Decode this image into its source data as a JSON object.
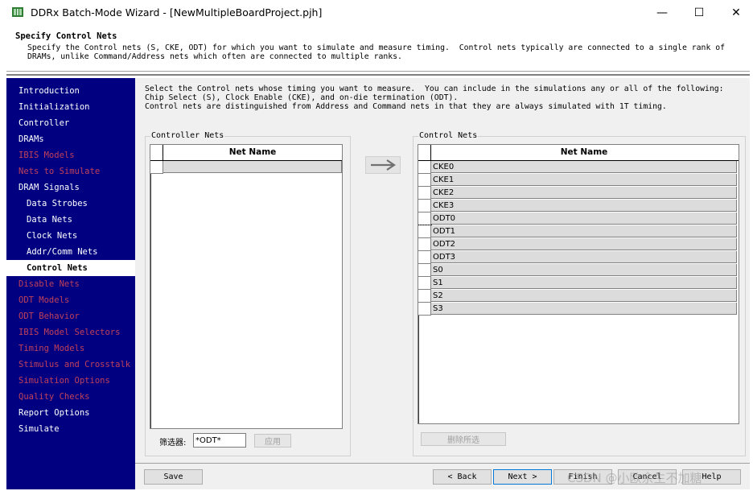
{
  "window": {
    "title": "DDRx Batch-Mode Wizard - [NewMultipleBoardProject.pjh]",
    "minimize_glyph": "—",
    "maximize_glyph": "☐",
    "close_glyph": "✕"
  },
  "header": {
    "title": "Specify Control Nets",
    "description": "Specify the Control nets (S, CKE, ODT) for which you want to simulate and measure timing.  Control nets typically are connected to a single rank of\nDRAMs, unlike Command/Address nets which often are connected to multiple ranks."
  },
  "sidebar": {
    "items": [
      {
        "label": "Introduction",
        "state": "normal",
        "indent": 0
      },
      {
        "label": "Initialization",
        "state": "normal",
        "indent": 0
      },
      {
        "label": "Controller",
        "state": "normal",
        "indent": 0
      },
      {
        "label": "DRAMs",
        "state": "normal",
        "indent": 0
      },
      {
        "label": "IBIS Models",
        "state": "disabled",
        "indent": 0
      },
      {
        "label": "Nets to Simulate",
        "state": "disabled",
        "indent": 0
      },
      {
        "label": "DRAM Signals",
        "state": "normal",
        "indent": 0
      },
      {
        "label": "Data Strobes",
        "state": "normal",
        "indent": 1
      },
      {
        "label": "Data Nets",
        "state": "normal",
        "indent": 1
      },
      {
        "label": "Clock Nets",
        "state": "normal",
        "indent": 1
      },
      {
        "label": "Addr/Comm Nets",
        "state": "normal",
        "indent": 1
      },
      {
        "label": "Control Nets",
        "state": "selected",
        "indent": 1
      },
      {
        "label": "Disable Nets",
        "state": "disabled",
        "indent": 0
      },
      {
        "label": "ODT Models",
        "state": "disabled",
        "indent": 0
      },
      {
        "label": "ODT Behavior",
        "state": "disabled",
        "indent": 0
      },
      {
        "label": "IBIS Model Selectors",
        "state": "disabled",
        "indent": 0
      },
      {
        "label": "Timing Models",
        "state": "disabled",
        "indent": 0
      },
      {
        "label": "Stimulus and Crosstalk",
        "state": "disabled",
        "indent": 0
      },
      {
        "label": "Simulation Options",
        "state": "disabled",
        "indent": 0
      },
      {
        "label": "Quality Checks",
        "state": "disabled",
        "indent": 0
      },
      {
        "label": "Report Options",
        "state": "normal",
        "indent": 0
      },
      {
        "label": "Simulate",
        "state": "normal",
        "indent": 0
      }
    ]
  },
  "main": {
    "instructions": "Select the Control nets whose timing you want to measure.  You can include in the simulations any or all of the following:\nChip Select (S), Clock Enable (CKE), and on-die termination (ODT).\nControl nets are distinguished from Address and Command nets in that they are always simulated with 1T timing.",
    "controller_nets": {
      "group_label": "Controller Nets",
      "column_header": "Net Name",
      "rows": [
        ""
      ]
    },
    "control_nets": {
      "group_label": "Control Nets",
      "column_header": "Net Name",
      "rows": [
        "CKE0",
        "CKE1",
        "CKE2",
        "CKE3",
        "ODT0",
        "ODT1",
        "ODT2",
        "ODT3",
        "S0",
        "S1",
        "S2",
        "S3"
      ],
      "focused_row": "ODT1"
    },
    "filter": {
      "label": "筛选器:",
      "value": "*ODT*",
      "apply_label": "应用"
    },
    "remove_selected_label": "删除所选",
    "move_right_icon": "arrow-right-icon"
  },
  "footer": {
    "save_label": "Save",
    "back_label": "< Back",
    "next_label": "Next >",
    "finish_label": "Finish",
    "cancel_label": "Cancel",
    "help_label": "Help"
  },
  "watermark": "CSDN @小欧余生不加糖",
  "colors": {
    "nav_background": "#000080",
    "nav_disabled_text": "#c0405a",
    "grid_cell": "#dcdcdc",
    "panel": "#f0f0f0"
  }
}
